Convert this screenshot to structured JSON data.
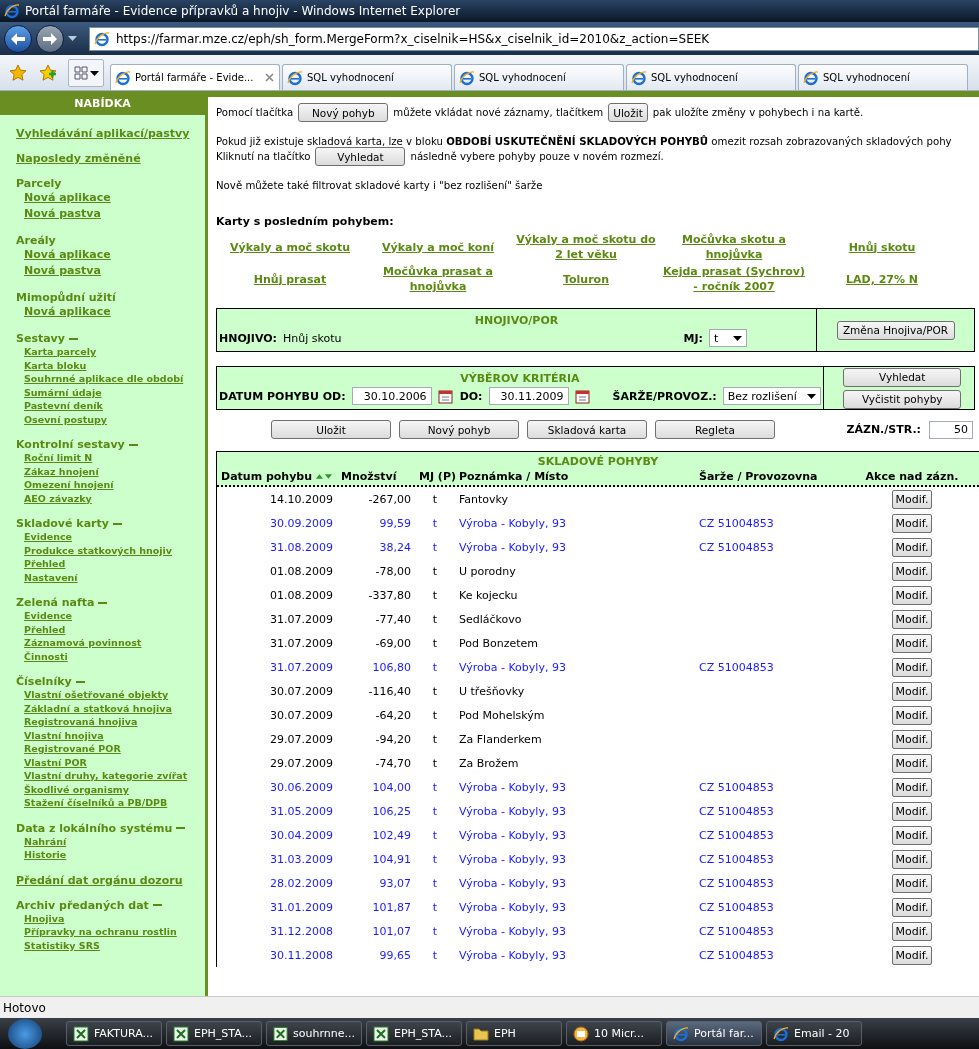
{
  "window": {
    "title": "Portál farmáře - Evidence přípravků a hnojiv - Windows Internet Explorer"
  },
  "address_bar": {
    "url": "https://farmar.mze.cz/eph/sh_form.MergeForm?x_ciselnik=HS&x_ciselnik_id=2010&z_action=SEEK"
  },
  "tabs": [
    {
      "label": "Portál farmáře - Evide...",
      "selected": true
    },
    {
      "label": "SQL vyhodnocení",
      "selected": false
    },
    {
      "label": "SQL vyhodnocení",
      "selected": false
    },
    {
      "label": "SQL vyhodnocení",
      "selected": false
    },
    {
      "label": "SQL vyhodnocení",
      "selected": false
    }
  ],
  "sidebar": {
    "title": "NABÍDKA",
    "sections": [
      {
        "kind": "link",
        "title": "Vyhledávání aplikací/pastvy"
      },
      {
        "kind": "link",
        "title": "Naposledy změněné"
      },
      {
        "kind": "group",
        "title": "Parcely",
        "items": [
          "Nová aplikace",
          "Nová pastva"
        ]
      },
      {
        "kind": "group",
        "title": "Areály",
        "items": [
          "Nová aplikace",
          "Nová pastva"
        ]
      },
      {
        "kind": "group",
        "title": "Mimopůdní užití",
        "items": [
          "Nová aplikace"
        ]
      },
      {
        "kind": "menu",
        "title": "Sestavy",
        "expanded": true,
        "items": [
          "Karta parcely",
          "Karta bloku",
          "Souhrnné aplikace dle období",
          "Sumární údaje",
          "Pastevní deník",
          "Osevní postupy"
        ]
      },
      {
        "kind": "menu",
        "title": "Kontrolní sestavy",
        "expanded": true,
        "items": [
          "Roční limit N",
          "Zákaz hnojení",
          "Omezení hnojení",
          "AEO závazky"
        ]
      },
      {
        "kind": "menu",
        "title": "Skladové karty",
        "expanded": true,
        "items": [
          "Evidence",
          "Produkce statkových hnojiv",
          "Přehled",
          "Nastavení"
        ]
      },
      {
        "kind": "menu",
        "title": "Zelená nafta",
        "expanded": true,
        "items": [
          "Evidence",
          "Přehled",
          "Záznamová povinnost",
          "Činnosti"
        ]
      },
      {
        "kind": "menu",
        "title": "Číselníky",
        "expanded": true,
        "items": [
          "Vlastní ošetřované objekty",
          "Základní a statková hnojiva",
          "Registrovaná hnojiva",
          "Vlastní hnojiva",
          "Registrované POR",
          "Vlastní POR",
          "Vlastní druhy, kategorie zvířat",
          "Škodlivé organismy",
          "Stažení číselníků a PB/DPB"
        ]
      },
      {
        "kind": "menu",
        "title": "Data z lokálního systému",
        "expanded": true,
        "items": [
          "Nahrání",
          "Historie"
        ]
      },
      {
        "kind": "link",
        "title": "Předání dat orgánu dozoru"
      },
      {
        "kind": "menu",
        "title": "Archiv předaných dat",
        "expanded": true,
        "items": [
          "Hnojiva",
          "Přípravky na ochranu rostlin",
          "Statistiky SRS"
        ]
      }
    ]
  },
  "intro": [
    {
      "parts": [
        {
          "kind": "text",
          "text": "Pomocí tlačítka"
        },
        {
          "kind": "button",
          "text": "Nový pohyb"
        },
        {
          "kind": "text",
          "text": "můžete vkládat nové záznamy, tlačítkem"
        },
        {
          "kind": "button",
          "text": "Uložit"
        },
        {
          "kind": "text",
          "text": "pak uložíte změny v pohybech i na kartě."
        }
      ]
    },
    {
      "parts": [
        {
          "kind": "text",
          "text": "Pokud již existuje skladová karta, lze v bloku **OBDOBÍ USKUTEČNĚNÍ SKLADOVÝCH POHYBŮ** omezit rozsah zobrazovaných skladových pohy"
        }
      ]
    },
    {
      "parts": [
        {
          "kind": "text",
          "text": "Kliknutí na tlačítko"
        },
        {
          "kind": "button",
          "text": "Vyhledat"
        },
        {
          "kind": "text",
          "text": "následně vybere pohyby pouze v novém rozmezí."
        }
      ]
    },
    {
      "parts": [
        {
          "kind": "text",
          "text": "Nově můžete také filtrovat skladové karty i \"bez rozlišení\" šarže"
        }
      ]
    }
  ],
  "recent_cards": {
    "title": "Karty s posledním pohybem:",
    "items": [
      "Výkaly a moč skotu",
      "Výkaly a moč koní",
      "Výkaly a moč skotu do 2 let věku",
      "Močůvka skotu a hnojůvka",
      "Hnůj skotu",
      "Hnůj prasat",
      "Močůvka prasat a hnojůvka",
      "Toluron",
      "Kejda prasat (Sychrov) - ročník 2007",
      "LAD, 27% N"
    ]
  },
  "fertilizer_panel": {
    "title": "HNOJIVO/POR",
    "label": "HNOJIVO:",
    "value": "Hnůj skotu",
    "unit_label": "MJ:",
    "unit_value": "t",
    "button": "Změna Hnojiva/POR"
  },
  "criteria_panel": {
    "title": "VÝBĚROV KRITÉRIA",
    "date_from_label": "DATUM POHYBU OD:",
    "date_from": "30.10.2006",
    "date_to_label": "DO:",
    "date_to": "30.11.2009",
    "batch_label": "ŠARŽE/PROVOZ.:",
    "batch_value": "Bez rozlišení",
    "buttons": [
      "Vyhledat",
      "Vyčistit pohyby"
    ]
  },
  "actions": {
    "buttons": [
      "Uložit",
      "Nový pohyb",
      "Skladová karta",
      "Regleta"
    ],
    "per_page_label": "ZÁZN./STR.:",
    "per_page": "50"
  },
  "movements": {
    "title": "SKLADOVÉ POHYBY",
    "columns": [
      "Datum pohybu",
      "Množství",
      "MJ (P)",
      "Poznámka / Místo",
      "Šarže / Provozovna",
      "Akce nad zázn."
    ],
    "rows": [
      {
        "kind": "issue",
        "date": "14.10.2009",
        "amount": "-267,00",
        "unit": "t",
        "note": "Fantovky",
        "action": "Modif."
      },
      {
        "kind": "receipt",
        "date": "30.09.2009",
        "amount": "99,59",
        "unit": "t",
        "note": "Výroba - Kobyly, 93",
        "batch": "CZ 51004853",
        "action": "Modif."
      },
      {
        "kind": "receipt",
        "date": "31.08.2009",
        "amount": "38,24",
        "unit": "t",
        "note": "Výroba - Kobyly, 93",
        "batch": "CZ 51004853",
        "action": "Modif."
      },
      {
        "kind": "issue",
        "date": "01.08.2009",
        "amount": "-78,00",
        "unit": "t",
        "note": "U porodny",
        "action": "Modif."
      },
      {
        "kind": "issue",
        "date": "01.08.2009",
        "amount": "-337,80",
        "unit": "t",
        "note": "Ke kojecku",
        "action": "Modif."
      },
      {
        "kind": "issue",
        "date": "31.07.2009",
        "amount": "-77,40",
        "unit": "t",
        "note": "Sedláčkovo",
        "action": "Modif."
      },
      {
        "kind": "issue",
        "date": "31.07.2009",
        "amount": "-69,00",
        "unit": "t",
        "note": "Pod Bonzetem",
        "action": "Modif."
      },
      {
        "kind": "receipt",
        "date": "31.07.2009",
        "amount": "106,80",
        "unit": "t",
        "note": "Výroba - Kobyly, 93",
        "batch": "CZ 51004853",
        "action": "Modif."
      },
      {
        "kind": "issue",
        "date": "30.07.2009",
        "amount": "-116,40",
        "unit": "t",
        "note": "U třešňovky",
        "action": "Modif."
      },
      {
        "kind": "issue",
        "date": "30.07.2009",
        "amount": "-64,20",
        "unit": "t",
        "note": "Pod Mohelským",
        "action": "Modif."
      },
      {
        "kind": "issue",
        "date": "29.07.2009",
        "amount": "-94,20",
        "unit": "t",
        "note": "Za Flanderkem",
        "action": "Modif."
      },
      {
        "kind": "issue",
        "date": "29.07.2009",
        "amount": "-74,70",
        "unit": "t",
        "note": "Za Brožem",
        "action": "Modif."
      },
      {
        "kind": "receipt",
        "date": "30.06.2009",
        "amount": "104,00",
        "unit": "t",
        "note": "Výroba - Kobyly, 93",
        "batch": "CZ 51004853",
        "action": "Modif."
      },
      {
        "kind": "receipt",
        "date": "31.05.2009",
        "amount": "106,25",
        "unit": "t",
        "note": "Výroba - Kobyly, 93",
        "batch": "CZ 51004853",
        "action": "Modif."
      },
      {
        "kind": "receipt",
        "date": "30.04.2009",
        "amount": "102,49",
        "unit": "t",
        "note": "Výroba - Kobyly, 93",
        "batch": "CZ 51004853",
        "action": "Modif."
      },
      {
        "kind": "receipt",
        "date": "31.03.2009",
        "amount": "104,91",
        "unit": "t",
        "note": "Výroba - Kobyly, 93",
        "batch": "CZ 51004853",
        "action": "Modif."
      },
      {
        "kind": "receipt",
        "date": "28.02.2009",
        "amount": "93,07",
        "unit": "t",
        "note": "Výroba - Kobyly, 93",
        "batch": "CZ 51004853",
        "action": "Modif."
      },
      {
        "kind": "receipt",
        "date": "31.01.2009",
        "amount": "101,87",
        "unit": "t",
        "note": "Výroba - Kobyly, 93",
        "batch": "CZ 51004853",
        "action": "Modif."
      },
      {
        "kind": "receipt",
        "date": "31.12.2008",
        "amount": "101,07",
        "unit": "t",
        "note": "Výroba - Kobyly, 93",
        "batch": "CZ 51004853",
        "action": "Modif."
      },
      {
        "kind": "receipt",
        "date": "30.11.2008",
        "amount": "99,65",
        "unit": "t",
        "note": "Výroba - Kobyly, 93",
        "batch": "CZ 51004853",
        "action": "Modif."
      }
    ]
  },
  "status_bar": {
    "text": "Hotovo"
  },
  "taskbar": [
    {
      "kind": "excel",
      "label": "FAKTURA...",
      "selected": false
    },
    {
      "kind": "excel",
      "label": "EPH_STA...",
      "selected": false
    },
    {
      "kind": "excel",
      "label": "souhrnne...",
      "selected": false
    },
    {
      "kind": "excel",
      "label": "EPH_STA...",
      "selected": false
    },
    {
      "kind": "folder",
      "label": "EPH",
      "selected": false
    },
    {
      "kind": "outlook",
      "label": "10 Micr...",
      "selected": false
    },
    {
      "kind": "ie",
      "label": "Portál far...",
      "selected": true
    },
    {
      "kind": "ie",
      "label": "Email - 20",
      "selected": false
    }
  ]
}
